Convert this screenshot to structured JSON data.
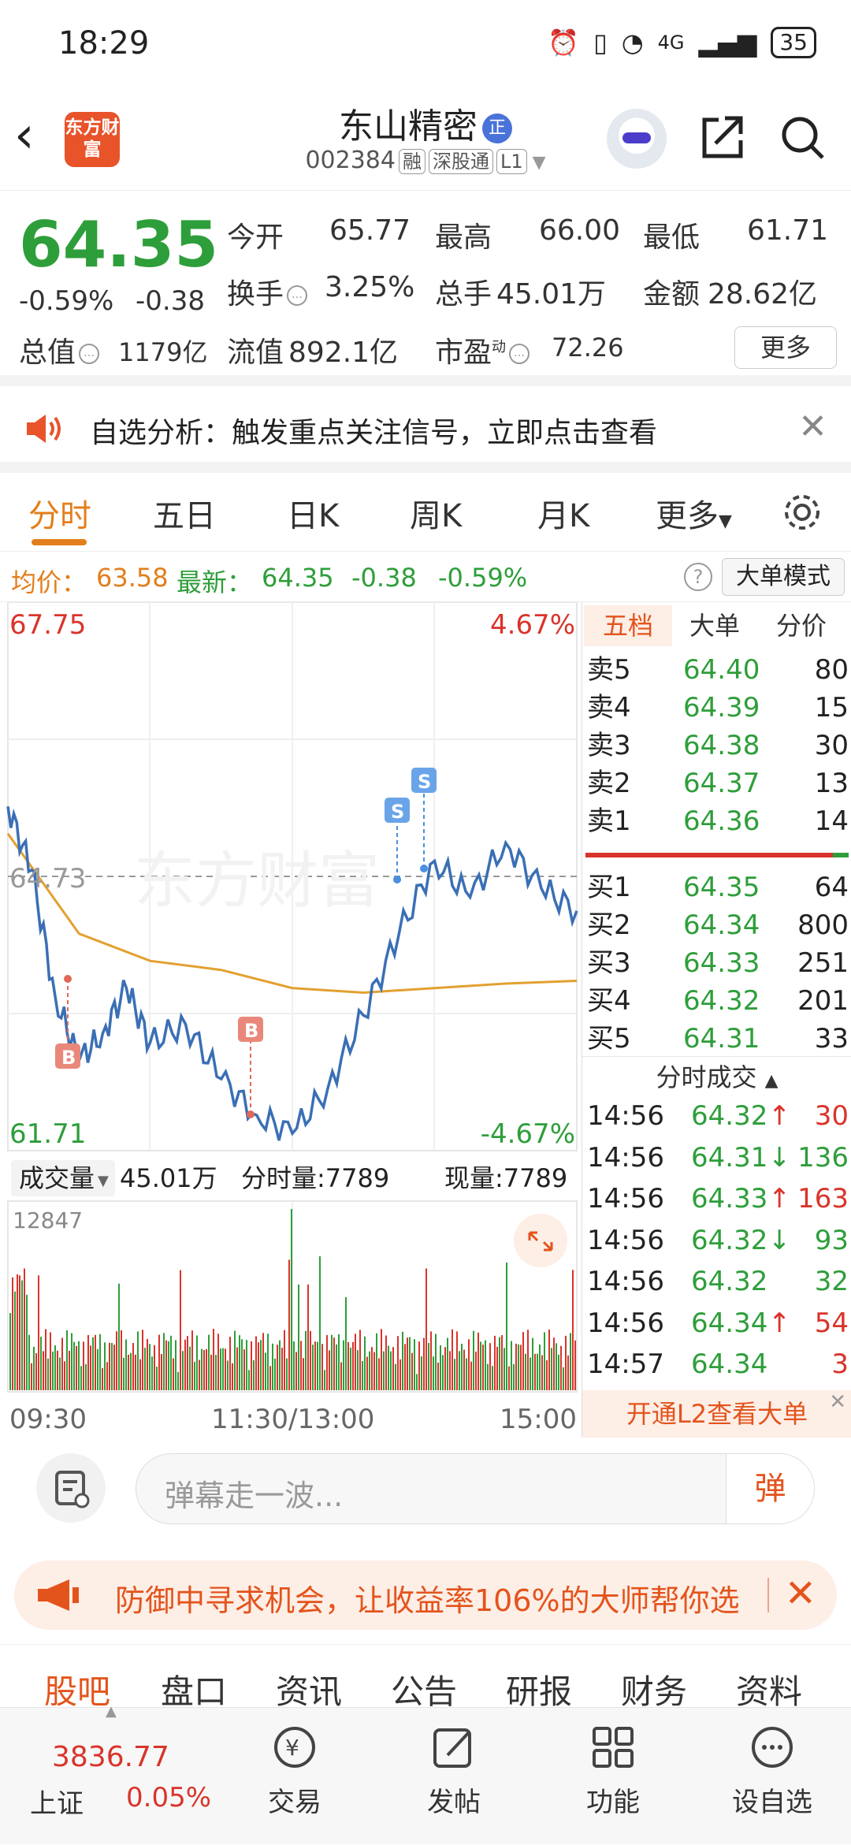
{
  "status_bar": {
    "time": "18:29",
    "network": "4G",
    "battery": "35"
  },
  "header": {
    "back_icon": "chevron-left-icon",
    "logo_text": "东方财富",
    "stock_name": "东山精密",
    "stock_badge": "正",
    "stock_code": "002384",
    "tags": [
      "融",
      "深股通",
      "L1"
    ],
    "actions": [
      "robot-assistant-icon",
      "share-icon",
      "search-icon"
    ]
  },
  "quote": {
    "price": "64.35",
    "change_pct": "-0.59%",
    "change_abs": "-0.38",
    "open_label": "今开",
    "open": "65.77",
    "high_label": "最高",
    "high": "66.00",
    "low_label": "最低",
    "low": "61.71",
    "turnover_label": "换手",
    "turnover": "3.25%",
    "volume_label": "总手",
    "volume": "45.01万",
    "amount_label": "金额",
    "amount": "28.62亿",
    "mktcap_label": "总值",
    "mktcap": "1179亿",
    "float_label": "流值",
    "float": "892.1亿",
    "pe_label": "市盈",
    "pe_sup": "动",
    "pe": "72.26",
    "more_label": "更多"
  },
  "alert": {
    "text": "自选分析：触发重点关注信号，立即点击查看"
  },
  "tabs": {
    "items": [
      "分时",
      "五日",
      "日K",
      "周K",
      "月K",
      "更多"
    ],
    "active": "分时"
  },
  "info_row": {
    "avg_label": "均价：",
    "avg": "63.58",
    "latest_label": "最新：",
    "latest": "64.35",
    "change_abs": "-0.38",
    "change_pct": "-0.59%",
    "mode_button": "大单模式"
  },
  "chart_labels": {
    "y_top": "67.75",
    "y_mid": "64.73",
    "y_bottom": "61.71",
    "pct_top": "4.67%",
    "pct_bottom": "-4.67%",
    "x_start": "09:30",
    "x_mid": "11:30/13:00",
    "x_end": "15:00",
    "vol_selector": "成交量",
    "vol_total": "45.01万",
    "vol_tick_label": "分时量:7789",
    "vol_now_label": "现量:7789",
    "vol_max": "12847",
    "markers": [
      "B",
      "B",
      "S",
      "S"
    ],
    "watermark": "东方财富"
  },
  "chart_data": {
    "type": "line",
    "x_range": [
      "09:30",
      "15:00"
    ],
    "ylim": [
      61.71,
      67.75
    ],
    "series": [
      {
        "name": "最新",
        "x": [
          "09:30",
          "09:40",
          "09:50",
          "10:00",
          "10:10",
          "10:20",
          "10:30",
          "10:45",
          "11:00",
          "11:15",
          "11:30",
          "13:15",
          "13:30",
          "13:45",
          "14:00",
          "14:15",
          "14:30",
          "14:45",
          "15:00"
        ],
        "values": [
          65.5,
          64.8,
          63.4,
          62.7,
          63.0,
          63.5,
          62.9,
          63.1,
          62.5,
          62.1,
          61.9,
          62.4,
          63.2,
          64.1,
          64.9,
          64.5,
          65.1,
          64.6,
          64.35
        ]
      },
      {
        "name": "均价",
        "x": [
          "09:30",
          "10:00",
          "10:30",
          "11:00",
          "11:30",
          "13:30",
          "14:00",
          "14:30",
          "15:00"
        ],
        "values": [
          65.2,
          64.1,
          63.8,
          63.7,
          63.5,
          63.45,
          63.5,
          63.55,
          63.58
        ]
      }
    ]
  },
  "order_book": {
    "tabs": [
      "五档",
      "大单",
      "分价"
    ],
    "asks": [
      {
        "label": "卖5",
        "price": "64.40",
        "vol": "80"
      },
      {
        "label": "卖4",
        "price": "64.39",
        "vol": "15"
      },
      {
        "label": "卖3",
        "price": "64.38",
        "vol": "30"
      },
      {
        "label": "卖2",
        "price": "64.37",
        "vol": "13"
      },
      {
        "label": "卖1",
        "price": "64.36",
        "vol": "14"
      }
    ],
    "bids": [
      {
        "label": "买1",
        "price": "64.35",
        "vol": "64"
      },
      {
        "label": "买2",
        "price": "64.34",
        "vol": "800"
      },
      {
        "label": "买3",
        "price": "64.33",
        "vol": "251"
      },
      {
        "label": "买4",
        "price": "64.32",
        "vol": "201"
      },
      {
        "label": "买5",
        "price": "64.31",
        "vol": "33"
      }
    ],
    "ticks_title": "分时成交",
    "ticks": [
      {
        "time": "14:56",
        "price": "64.32",
        "dir": "↑",
        "vol": "30",
        "color": "red"
      },
      {
        "time": "14:56",
        "price": "64.31",
        "dir": "↓",
        "vol": "136",
        "color": "green"
      },
      {
        "time": "14:56",
        "price": "64.33",
        "dir": "↑",
        "vol": "163",
        "color": "red"
      },
      {
        "time": "14:56",
        "price": "64.32",
        "dir": "↓",
        "vol": "93",
        "color": "green"
      },
      {
        "time": "14:56",
        "price": "64.32",
        "dir": "",
        "vol": "32",
        "color": "green"
      },
      {
        "time": "14:56",
        "price": "64.34",
        "dir": "↑",
        "vol": "54",
        "color": "red"
      },
      {
        "time": "14:57",
        "price": "64.34",
        "dir": "",
        "vol": "3",
        "color": "red"
      }
    ],
    "l2_banner": "开通L2查看大单"
  },
  "danmu": {
    "placeholder": "弹幕走一波...",
    "send_label": "弹"
  },
  "ad": {
    "text": "防御中寻求机会，让收益率106%的大师帮你选"
  },
  "bottom_tabs": {
    "items": [
      "股吧",
      "盘口",
      "资讯",
      "公告",
      "研报",
      "财务",
      "资料"
    ],
    "active": "股吧"
  },
  "navbar": {
    "index_name": "上证",
    "index_value": "3836.77",
    "index_change": "0.05%",
    "items": [
      "交易",
      "发帖",
      "功能",
      "设自选"
    ]
  },
  "colors": {
    "up": "#d9342b",
    "down": "#2e9e3a",
    "accent": "#e37e1c",
    "avg_line": "#e3a030",
    "price_line": "#3a6fb5"
  }
}
